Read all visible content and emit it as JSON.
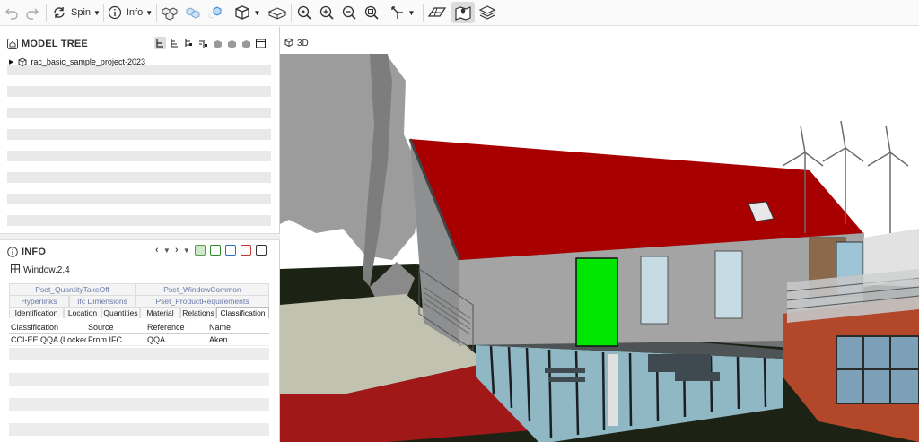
{
  "toolbar": {
    "spin_label": "Spin",
    "info_label": "Info"
  },
  "model_tree": {
    "title": "MODEL TREE",
    "root_item": "rac_basic_sample_project-2023"
  },
  "info": {
    "title": "INFO",
    "element_name": "Window.2.4",
    "tabs_row1": [
      "Pset_QuantityTakeOff",
      "Pset_WindowCommon"
    ],
    "tabs_row2": [
      "Hyperlinks",
      "Ifc Dimensions",
      "Pset_ProductRequirements"
    ],
    "tabs_row3": [
      "Identification",
      "Location",
      "Quantities",
      "Material",
      "Relations",
      "Classification"
    ],
    "selected_tab": "Classification",
    "table": {
      "headers": [
        "Classification",
        "Source",
        "Reference",
        "Name"
      ],
      "rows": [
        [
          "CCI-EE QQA (Locked)",
          "From IFC",
          "QQA",
          "Aken"
        ]
      ]
    }
  },
  "viewport": {
    "title": "3D",
    "colors": {
      "roof": "#a80000",
      "selected_window": "#00e600",
      "ground": "#1c2314",
      "walls": "#a4a4a4"
    }
  }
}
